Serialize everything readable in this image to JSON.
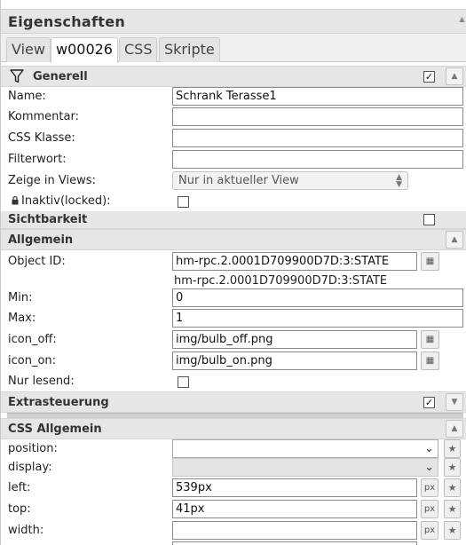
{
  "title": "Eigenschaften",
  "tabs": [
    "View",
    "w00026",
    "CSS",
    "Skripte"
  ],
  "sections": {
    "generell": "Generell",
    "sichtbarkeit": "Sichtbarkeit",
    "allgemein": "Allgemein",
    "extrasteuerung": "Extrasteuerung",
    "css_allgemein": "CSS Allgemein"
  },
  "generell": {
    "name_label": "Name:",
    "name_value": "Schrank Terasse1",
    "kommentar_label": "Kommentar:",
    "kommentar_value": "",
    "css_klasse_label": "CSS Klasse:",
    "css_klasse_value": "",
    "filterwort_label": "Filterwort:",
    "filterwort_value": "",
    "zeige_label": "Zeige in Views:",
    "zeige_value": "Nur in aktueller View",
    "inaktiv_label": "Inaktiv(locked):"
  },
  "allgemein": {
    "object_id_label": "Object ID:",
    "object_id_value": "hm-rpc.2.0001D709900D7D:3:STATE",
    "object_id_resolved": "hm-rpc.2.0001D709900D7D:3:STATE",
    "min_label": "Min:",
    "min_value": "0",
    "max_label": "Max:",
    "max_value": "1",
    "icon_off_label": "icon_off:",
    "icon_off_value": "img/bulb_off.png",
    "icon_on_label": "icon_on:",
    "icon_on_value": "img/bulb_on.png",
    "nur_lesend_label": "Nur lesend:"
  },
  "css_allgemein": {
    "position_label": "position:",
    "display_label": "display:",
    "left_label": "left:",
    "left_value": "539px",
    "top_label": "top:",
    "top_value": "41px",
    "width_label": "width:",
    "width_value": "",
    "px_unit": "px"
  },
  "icons": {
    "filter": "filter-icon",
    "check": "✓",
    "collapse": "▲",
    "expand": "▼",
    "pick": "▦",
    "star": "★",
    "lock": "lock-icon"
  },
  "checked": {
    "generell": true,
    "sichtbarkeit": false,
    "extrasteuerung": true,
    "inaktiv": false,
    "nur_lesend": false
  }
}
